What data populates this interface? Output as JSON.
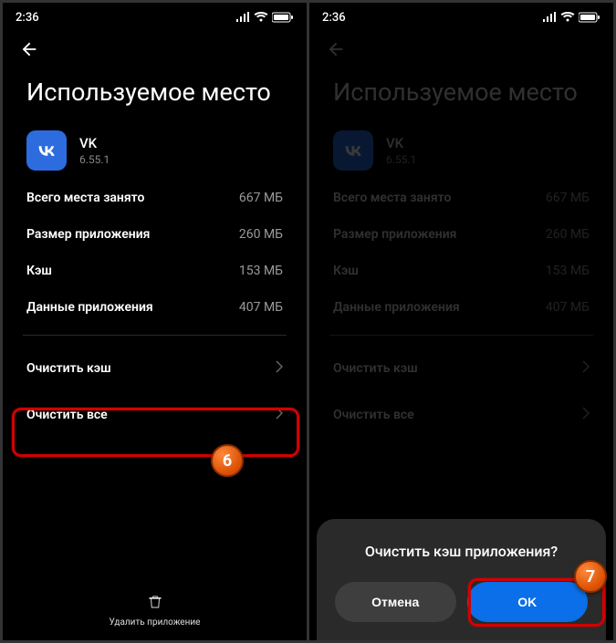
{
  "status": {
    "time": "2:36"
  },
  "page": {
    "title": "Используемое место"
  },
  "app": {
    "name": "VK",
    "version": "6.55.1"
  },
  "storage": {
    "total": {
      "label": "Всего места занято",
      "value": "667 МБ"
    },
    "app_size": {
      "label": "Размер приложения",
      "value": "260 МБ"
    },
    "cache": {
      "label": "Кэш",
      "value": "153 МБ"
    },
    "data": {
      "label": "Данные приложения",
      "value": "407 МБ"
    }
  },
  "actions": {
    "clear_cache": "Очистить кэш",
    "clear_all": "Очистить все",
    "delete_app": "Удалить приложение"
  },
  "dialog": {
    "title": "Очистить кэш приложения?",
    "cancel": "Отмена",
    "ok": "OK"
  },
  "steps": {
    "six": "6",
    "seven": "7"
  }
}
